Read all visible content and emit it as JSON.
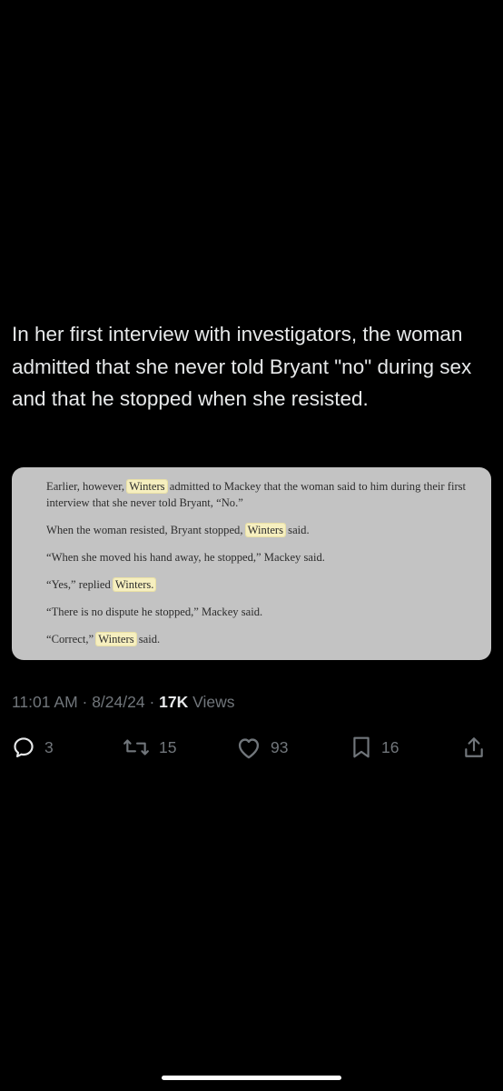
{
  "tweet": {
    "text": "In her first interview with investigators, the woman admitted that she never told Bryant \"no\" during sex and that he stopped when she resisted."
  },
  "article": {
    "p1_before": "Earlier, however, ",
    "p1_hl": "Winters",
    "p1_after": " admitted to Mackey that the woman said to him during their first interview that she never told Bryant, “No.”",
    "p2_before": "When the woman resisted, Bryant stopped, ",
    "p2_hl": "Winters",
    "p2_after": " said.",
    "p3": "“When she moved his hand away, he stopped,” Mackey said.",
    "p4_before": "“Yes,” replied ",
    "p4_hl": "Winters.",
    "p5": "“There is no dispute he stopped,” Mackey said.",
    "p6_before": "“Correct,” ",
    "p6_hl": "Winters",
    "p6_after": " said."
  },
  "meta": {
    "time": "11:01 AM",
    "sep1": " · ",
    "date": "8/24/24",
    "sep2": " · ",
    "views_count": "17K",
    "views_label": " Views"
  },
  "actions": {
    "replies": "3",
    "reposts": "15",
    "likes": "93",
    "bookmarks": "16"
  },
  "icons": {
    "reply": "reply-icon",
    "repost": "repost-icon",
    "like": "heart-icon",
    "bookmark": "bookmark-icon",
    "share": "share-icon"
  },
  "colors": {
    "background": "#000000",
    "text": "#e7e9ea",
    "secondary": "#71767b",
    "highlight": "#f6efbf"
  }
}
